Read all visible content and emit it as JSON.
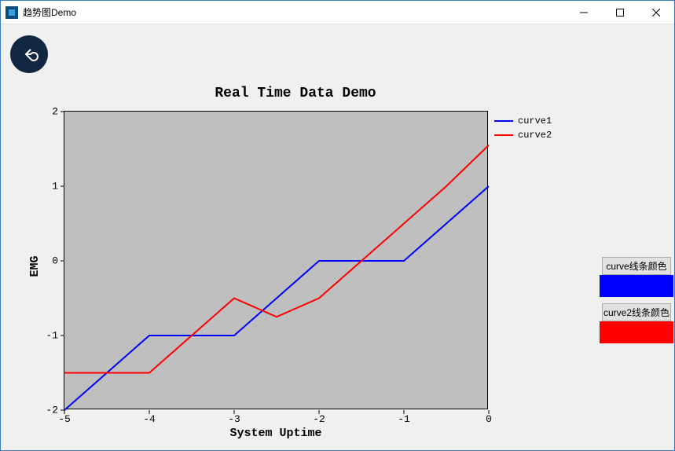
{
  "window": {
    "title": "趋势图Demo"
  },
  "chart_data": {
    "type": "line",
    "title": "Real Time Data Demo",
    "xlabel": "System Uptime",
    "ylabel": "EMG",
    "xlim": [
      -5,
      0
    ],
    "ylim": [
      -2,
      2
    ],
    "x_ticks": [
      -5,
      -4,
      -3,
      -2,
      -1,
      0
    ],
    "y_ticks": [
      -2,
      -1,
      0,
      1,
      2
    ],
    "x": [
      -5,
      -4.5,
      -4,
      -3.5,
      -3,
      -2.5,
      -2,
      -1.5,
      -1,
      -0.5,
      0
    ],
    "series": [
      {
        "name": "curve1",
        "color": "#0000ff",
        "values": [
          -2.0,
          -1.5,
          -1.0,
          -1.0,
          -1.0,
          -0.5,
          0.0,
          0.0,
          0.0,
          0.5,
          1.0
        ]
      },
      {
        "name": "curve2",
        "color": "#ff0000",
        "values": [
          -1.5,
          -1.5,
          -1.5,
          -1.0,
          -0.5,
          -0.75,
          -0.5,
          0.0,
          0.5,
          1.0,
          1.55
        ]
      }
    ]
  },
  "controls": {
    "curve1_btn": "curve线条颜色",
    "curve2_btn": "curve2线条颜色"
  }
}
